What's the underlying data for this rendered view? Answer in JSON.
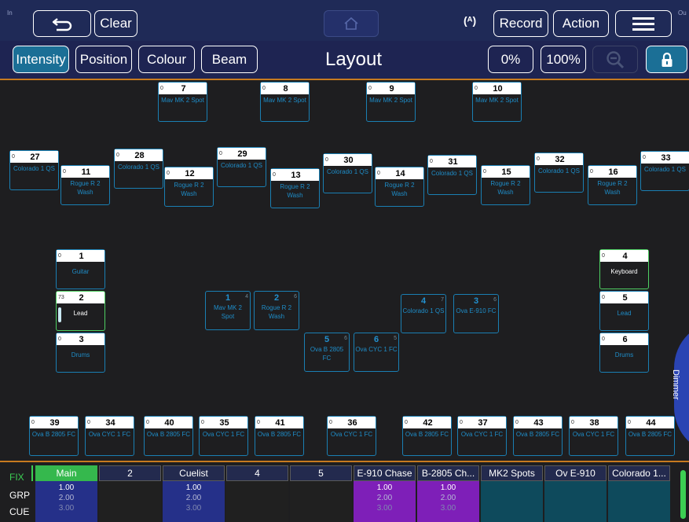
{
  "topbar": {
    "corner_left": "In",
    "corner_right": "Ou",
    "clear_label": "Clear",
    "record_label": "Record",
    "action_label": "Action",
    "icons": [
      "undo-icon",
      "home-icon",
      "radio-signal-icon",
      "menu-icon"
    ]
  },
  "toolbar": {
    "tabs": [
      "Intensity",
      "Position",
      "Colour",
      "Beam"
    ],
    "active_tab": "Intensity",
    "title": "Layout",
    "zero_label": "0%",
    "full_label": "100%",
    "icons": [
      "zoom-out-icon",
      "lock-icon"
    ]
  },
  "fixtures": [
    {
      "num": "7",
      "level": "0",
      "name": "Mav MK 2 Spot"
    },
    {
      "num": "8",
      "level": "0",
      "name": "Mav MK 2 Spot"
    },
    {
      "num": "9",
      "level": "0",
      "name": "Mav MK 2 Spot"
    },
    {
      "num": "10",
      "level": "0",
      "name": "Mav MK 2 Spot"
    },
    {
      "num": "27",
      "level": "0",
      "name": "Colorado 1 QS"
    },
    {
      "num": "28",
      "level": "0",
      "name": "Colorado 1 QS"
    },
    {
      "num": "29",
      "level": "0",
      "name": "Colorado 1 QS"
    },
    {
      "num": "30",
      "level": "0",
      "name": "Colorado 1 QS"
    },
    {
      "num": "31",
      "level": "0",
      "name": "Colorado 1 QS"
    },
    {
      "num": "32",
      "level": "0",
      "name": "Colorado 1 QS"
    },
    {
      "num": "33",
      "level": "0",
      "name": "Colorado 1 QS"
    },
    {
      "num": "11",
      "level": "0",
      "name": "Rogue R 2 Wash"
    },
    {
      "num": "12",
      "level": "0",
      "name": "Rogue R 2 Wash"
    },
    {
      "num": "13",
      "level": "0",
      "name": "Rogue R 2 Wash"
    },
    {
      "num": "14",
      "level": "0",
      "name": "Rogue R 2 Wash"
    },
    {
      "num": "15",
      "level": "0",
      "name": "Rogue R 2 Wash"
    },
    {
      "num": "16",
      "level": "0",
      "name": "Rogue R 2 Wash"
    },
    {
      "num": "1",
      "level": "0",
      "name": "Guitar"
    },
    {
      "num": "2",
      "level": "73",
      "name": "Lead"
    },
    {
      "num": "3",
      "level": "0",
      "name": "Drums"
    },
    {
      "num": "4",
      "level": "0",
      "name": "Keyboard"
    },
    {
      "num": "5",
      "level": "0",
      "name": "Lead"
    },
    {
      "num": "6",
      "level": "0",
      "name": "Drums"
    },
    {
      "num": "39",
      "level": "0",
      "name": "Ova B 2805 FC"
    },
    {
      "num": "34",
      "level": "0",
      "name": "Ova CYC 1 FC"
    },
    {
      "num": "40",
      "level": "0",
      "name": "Ova B 2805 FC"
    },
    {
      "num": "35",
      "level": "0",
      "name": "Ova CYC 1 FC"
    },
    {
      "num": "41",
      "level": "0",
      "name": "Ova B 2805 FC"
    },
    {
      "num": "36",
      "level": "0",
      "name": "Ova CYC 1 FC"
    },
    {
      "num": "42",
      "level": "0",
      "name": "Ova B 2805 FC"
    },
    {
      "num": "37",
      "level": "0",
      "name": "Ova CYC 1 FC"
    },
    {
      "num": "43",
      "level": "0",
      "name": "Ova B 2805 FC"
    },
    {
      "num": "38",
      "level": "0",
      "name": "Ova CYC 1 FC"
    },
    {
      "num": "44",
      "level": "0",
      "name": "Ova B 2805 FC"
    }
  ],
  "groups": [
    {
      "num": "1",
      "count": "4",
      "name": "Mav MK 2 Spot"
    },
    {
      "num": "2",
      "count": "6",
      "name": "Rogue R 2 Wash"
    },
    {
      "num": "4",
      "count": "7",
      "name": "Colorado 1 QS"
    },
    {
      "num": "3",
      "count": "6",
      "name": "Ova E-910 FC"
    },
    {
      "num": "5",
      "count": "6",
      "name": "Ova B 2805 FC"
    },
    {
      "num": "6",
      "count": "5",
      "name": "Ova CYC 1 FC"
    }
  ],
  "dimmer_tab": "Dimmer",
  "side_labels": [
    "FIX",
    "GRP",
    "CUE"
  ],
  "playbacks": [
    {
      "name": "Main",
      "v1": "1.00",
      "v2": "2.00",
      "v3": "3.00"
    },
    {
      "name": "2",
      "v1": "",
      "v2": "",
      "v3": ""
    },
    {
      "name": "Cuelist",
      "v1": "1.00",
      "v2": "2.00",
      "v3": "3.00"
    },
    {
      "name": "4",
      "v1": "",
      "v2": "",
      "v3": ""
    },
    {
      "name": "5",
      "v1": "",
      "v2": "",
      "v3": ""
    },
    {
      "name": "E-910 Chase",
      "v1": "1.00",
      "v2": "2.00",
      "v3": "3.00"
    },
    {
      "name": "B-2805 Ch...",
      "v1": "1.00",
      "v2": "2.00",
      "v3": "3.00"
    },
    {
      "name": "MK2 Spots",
      "v1": "",
      "v2": "",
      "v3": ""
    },
    {
      "name": "Ov E-910",
      "v1": "",
      "v2": "",
      "v3": ""
    },
    {
      "name": "Colorado 1...",
      "v1": "",
      "v2": "",
      "v3": ""
    }
  ],
  "colors": {
    "topbar": "#1f2a57",
    "accent_orange": "#c77a1f",
    "fixture_border": "#1a7fb3",
    "selected_green": "#4ecf63",
    "active_tab": "#1b6f96"
  }
}
